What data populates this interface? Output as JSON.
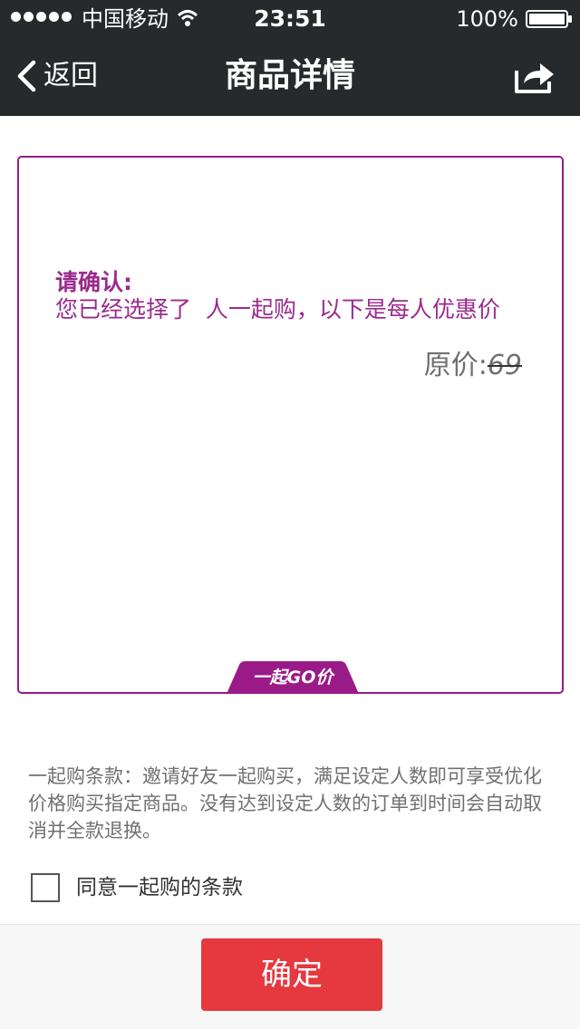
{
  "status_bar": {
    "carrier": "中国移动",
    "time": "23:51",
    "battery": "100%"
  },
  "nav": {
    "back_label": "返回",
    "title": "商品详情"
  },
  "card": {
    "confirm_title": "请确认:",
    "confirm_message": "您已经选择了  人一起购，以下是每人优惠价",
    "price_label": "原价:",
    "original_price": "69",
    "brand_tab": "一起GO价"
  },
  "terms": {
    "text": "一起购条款：邀请好友一起购买，满足设定人数即可享受优化价格购买指定商品。没有达到设定人数的订单到时间会自动取消并全款退换。",
    "agree_label": "同意一起购的条款",
    "agree_checked": false
  },
  "footer": {
    "confirm_label": "确定"
  },
  "colors": {
    "header_bg": "#262a2d",
    "accent_purple": "#9a1b88",
    "confirm_red": "#e5383f"
  },
  "icons": {
    "back": "chevron-left-icon",
    "share": "share-icon",
    "wifi": "wifi-icon",
    "battery": "battery-icon"
  }
}
